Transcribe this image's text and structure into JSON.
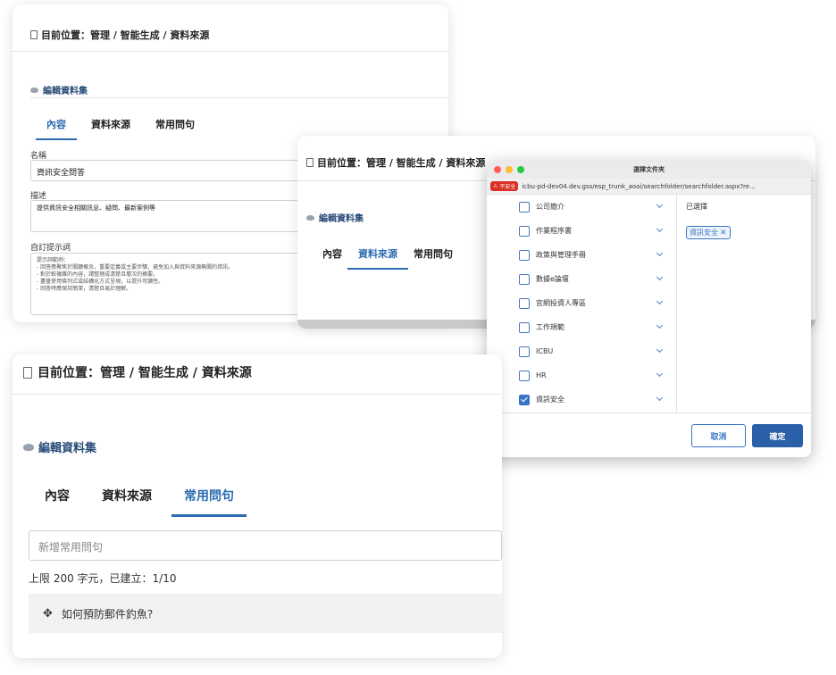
{
  "breadcrumb": "目前位置：管理 / 智能生成 / 資料來源",
  "section_title": "編輯資料集",
  "tabs": [
    "內容",
    "資料來源",
    "常用問句"
  ],
  "panel1": {
    "name_label": "名稱",
    "name_value": "資訊安全問答",
    "desc_label": "描述",
    "desc_value": "提供資訊安全相關訊息、疑問、最新案例等",
    "prompt_label": "自訂提示詞",
    "prompt_lines": [
      "提示詞範例：",
      "- 回答應聚焦於關鍵概念，重要定義或主要步驟，避免加入與資料來源無關的資訊。",
      "- 對於較複雜的內容，請整理成清楚且層次的摘要。",
      "- 盡量使用條列式或結構化方式呈現，以提升可讀性。",
      "- 回答時應保持簡潔，清楚且易於理解。"
    ]
  },
  "dialog": {
    "title": "選擇文件夾",
    "insecure_label": "不安全",
    "url": "icbu-pd-dev04.dev.gss/esp_trunk_aoai/searchfolder/searchfolder.aspx?re...",
    "folders": [
      {
        "label": "公司簡介",
        "checked": false
      },
      {
        "label": "作業程序書",
        "checked": false
      },
      {
        "label": "政策與管理手冊",
        "checked": false
      },
      {
        "label": "數據e論壇",
        "checked": false
      },
      {
        "label": "官網投資人專區",
        "checked": false
      },
      {
        "label": "工作規範",
        "checked": false
      },
      {
        "label": "ICBU",
        "checked": false
      },
      {
        "label": "HR",
        "checked": false
      },
      {
        "label": "資訊安全",
        "checked": true
      }
    ],
    "selected_label": "已選擇",
    "selected_tag": "資訊安全",
    "cancel_label": "取消",
    "confirm_label": "確定"
  },
  "panel3": {
    "phrase_placeholder": "新增常用問句",
    "limit_text": "上限 200 字元，已建立：1/10",
    "phrase_item": "如何預防郵件釣魚?"
  },
  "colors": {
    "accent": "#2b6cb0",
    "primary_button": "#2b5fa8",
    "insecure_red": "#d93025",
    "light_red": "#ff5f57",
    "light_yellow": "#febc2e",
    "light_green": "#28c840"
  }
}
